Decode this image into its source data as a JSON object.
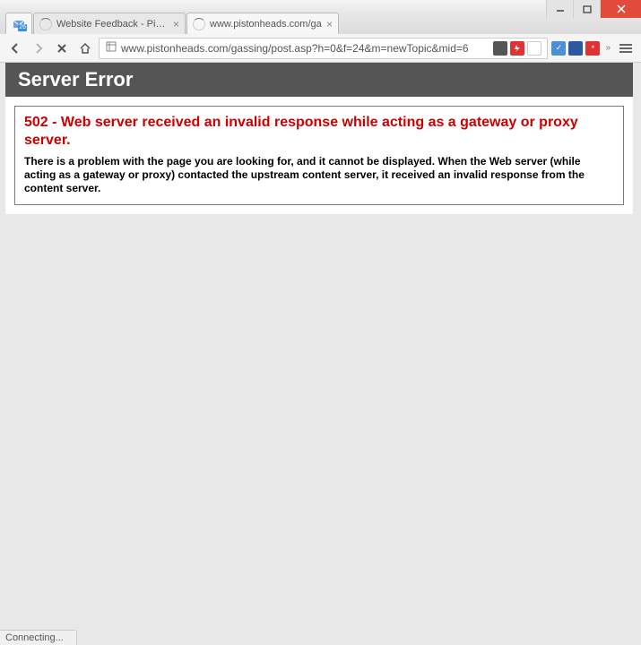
{
  "window": {
    "calendar_badge": "26"
  },
  "tabs": [
    {
      "title": "Website Feedback - Piston",
      "active": false
    },
    {
      "title": "www.pistonheads.com/ga",
      "active": true
    }
  ],
  "nav": {
    "url": "www.pistonheads.com/gassing/post.asp?h=0&f=24&m=newTopic&mid=6"
  },
  "page": {
    "header": "Server Error",
    "error_title": "502 - Web server received an invalid response while acting as a gateway or proxy server.",
    "error_body": "There is a problem with the page you are looking for, and it cannot be displayed. When the Web server (while acting as a gateway or proxy) contacted the upstream content server, it received an invalid response from the content server."
  },
  "status": {
    "text": "Connecting..."
  },
  "colors": {
    "close_btn": "#e04b3b",
    "error_red": "#cc0000",
    "header_bg": "#555555"
  }
}
